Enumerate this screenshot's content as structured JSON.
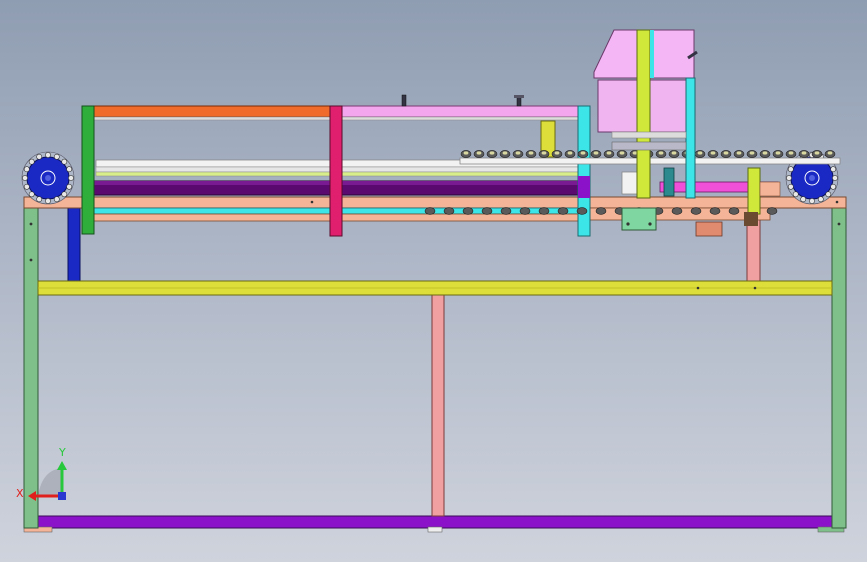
{
  "viewport": {
    "background_top": "#8f9db2",
    "background_bottom": "#cfd3dc"
  },
  "triad": {
    "x_label": "X",
    "y_label": "Y",
    "x_color": "#e0201c",
    "y_color": "#28c83c",
    "z_color": "#2a3ad0"
  },
  "colors": {
    "frame_green": "#7fc08a",
    "belt_purple": "#8b12c8",
    "beam_yellow": "#dede3a",
    "top_salmon": "#f4b497",
    "rail_orange": "#f06a2a",
    "rail_pink": "#f3a6ee",
    "magenta": "#e0206e",
    "cyan": "#3ce6e8",
    "lime": "#cfe83a",
    "sprocket_blue": "#1a28c4",
    "hood_pink": "#f4b6f4",
    "column_pink": "#f0a0a0"
  }
}
